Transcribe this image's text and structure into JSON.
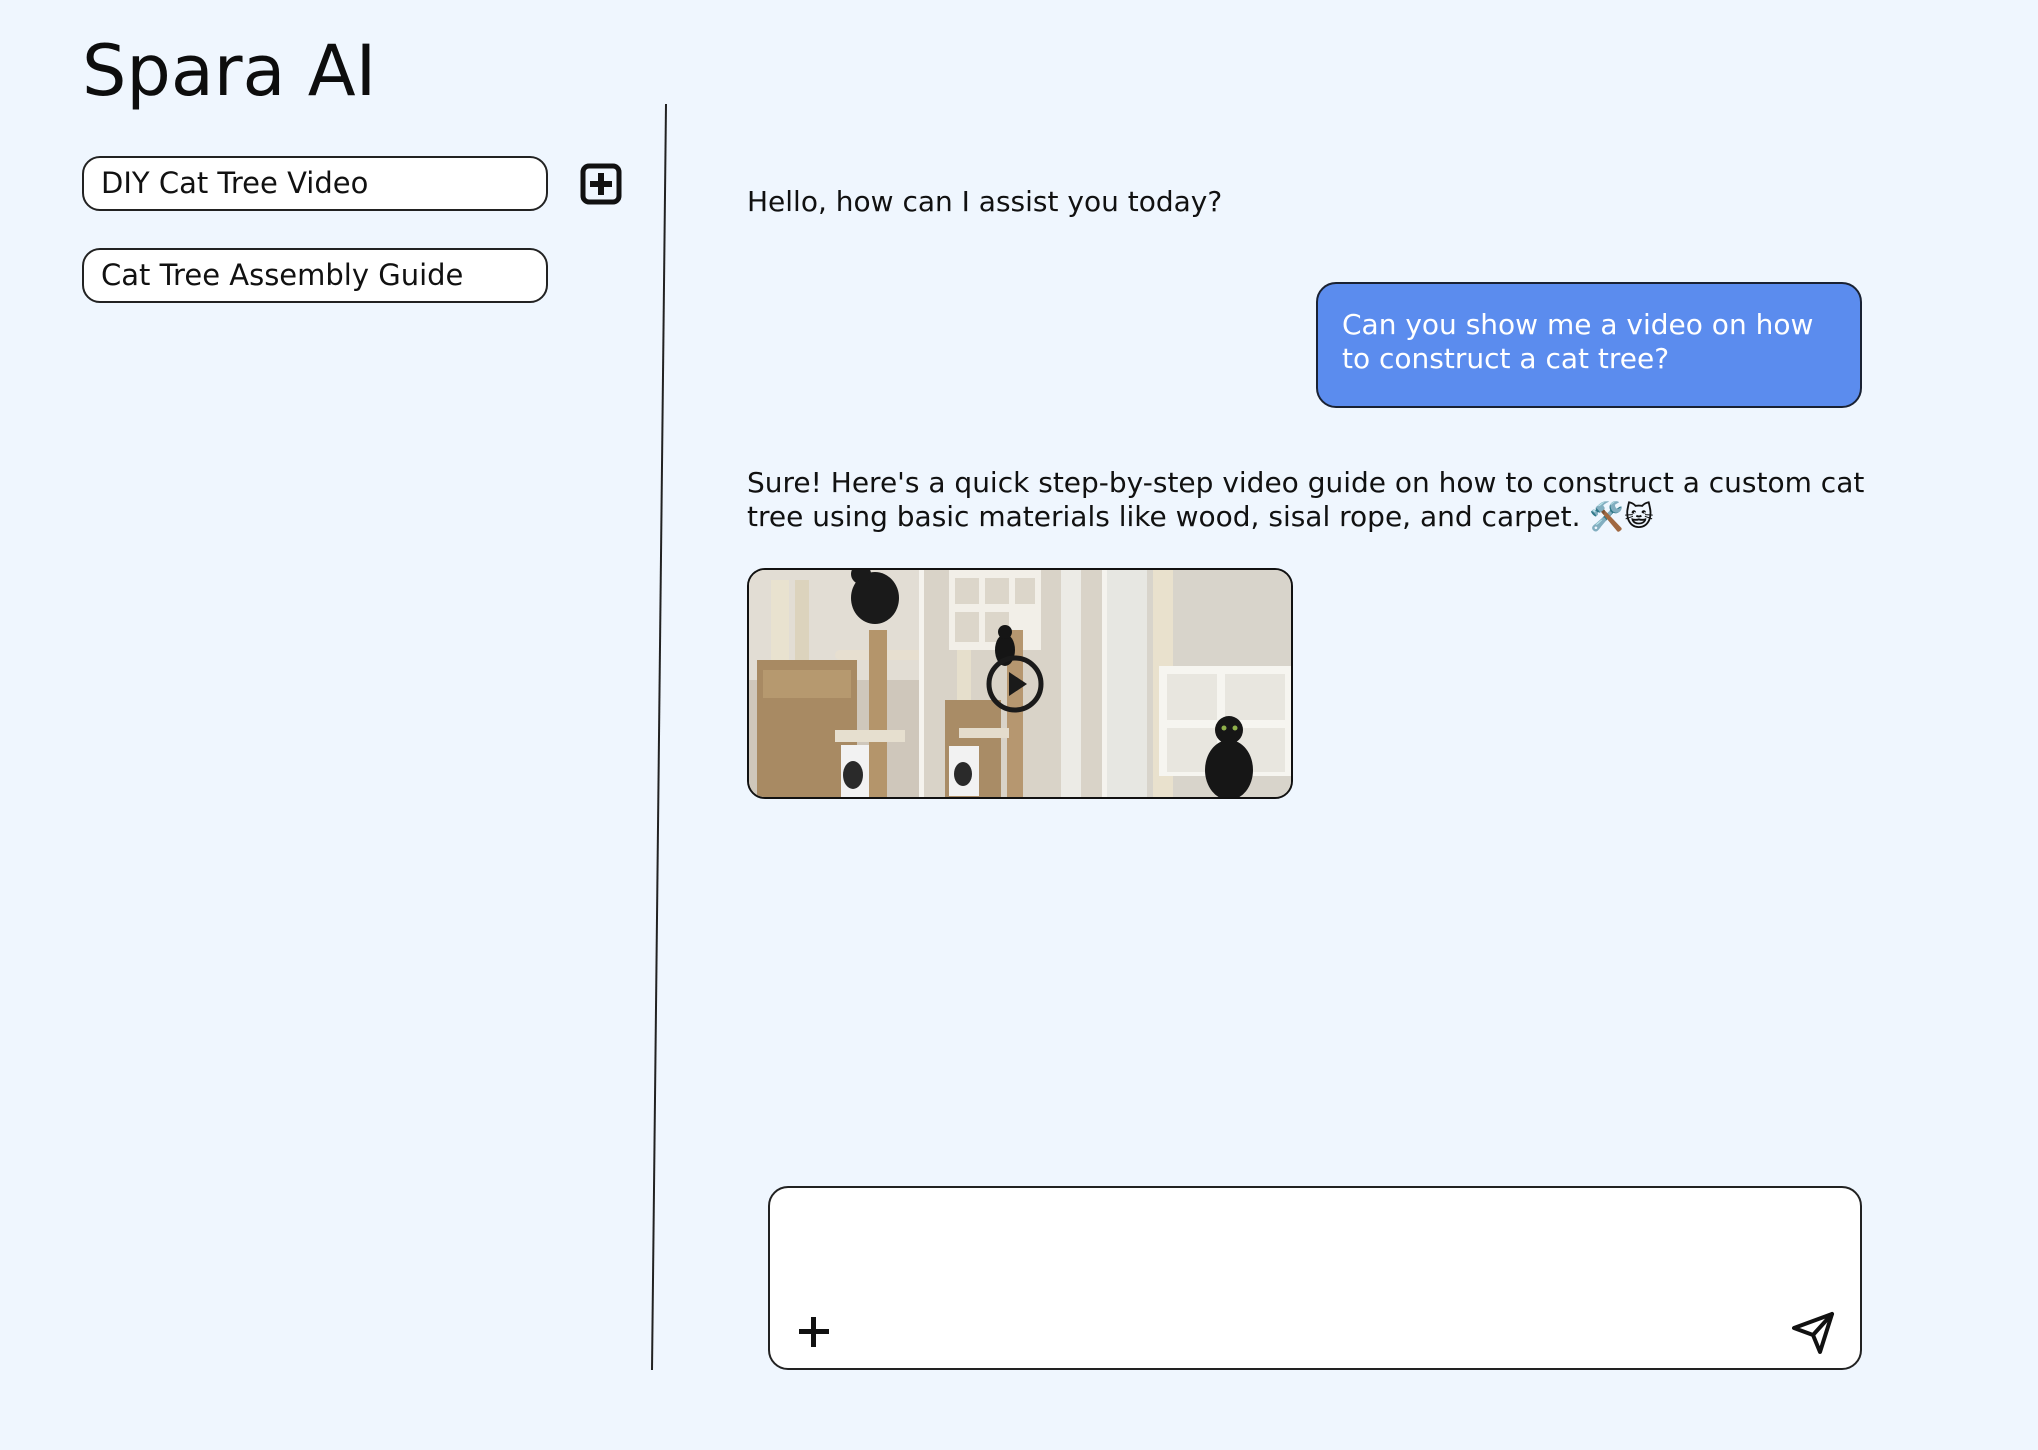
{
  "app": {
    "title": "Spara AI"
  },
  "sidebar": {
    "conversations": [
      {
        "label": "DIY Cat Tree Video"
      },
      {
        "label": "Cat Tree Assembly Guide"
      }
    ],
    "new_chat_icon": "plus-square-icon"
  },
  "chat": {
    "messages": [
      {
        "role": "assistant",
        "text": "Hello, how can I assist you today?"
      },
      {
        "role": "user",
        "text": "Can you show me a video on how to construct a cat tree?"
      },
      {
        "role": "assistant",
        "text": "Sure! Here's a quick step-by-step video guide on how to construct a custom cat tree using basic materials like wood, sisal rope, and carpet. 🛠️😺"
      }
    ],
    "video": {
      "icon": "play-icon"
    }
  },
  "composer": {
    "placeholder": "",
    "value": "",
    "attach_icon": "plus-icon",
    "send_icon": "send-icon"
  },
  "colors": {
    "background": "#eff6fe",
    "user_bubble": "#5b8cee",
    "surface": "#ffffff",
    "border": "#222222"
  }
}
